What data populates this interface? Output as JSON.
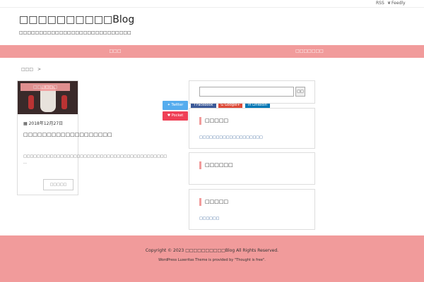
{
  "topbar": {
    "rss": "RSS",
    "feedly": "Feedly"
  },
  "site": {
    "title": "□□□□□□□□□□Blog",
    "description": "□□□□□□□□□□□□□□□□□□□□□□□□□□□□"
  },
  "nav": {
    "items": [
      "□□□",
      "□□□□□□□"
    ]
  },
  "breadcrumb": {
    "home": "□□□",
    "sep": ">"
  },
  "post": {
    "category": "□□□□□□",
    "date": "2018年12月27日",
    "title": "□□□□□□□□□□□□□□□□□□□",
    "excerpt": "□□□□□□□□□□□□□□□□□□□□□□□□□□□□□□□□□□□□□□□□□□□ …",
    "read_more": "□□□□□"
  },
  "share": {
    "twitter": "Twitter",
    "facebook": "Facebook",
    "google": "Google+",
    "linkedin": "LinkedIn",
    "pocket": "Pocket"
  },
  "sidebar": {
    "search_button": "□□",
    "recent": {
      "heading": "□□□□□",
      "link": "□□□□□□□□□□□□□□□□□□□"
    },
    "archive": {
      "heading": "□□□□□□"
    },
    "category": {
      "heading": "□□□□□",
      "link": "□□□□□□"
    }
  },
  "footer": {
    "copyright": "Copyright © 2023 □□□□□□□□□□Blog All Rights Reserved.",
    "credit": "WordPress Luxeritas Theme is provided by \"Thought is free\"."
  },
  "colors": {
    "accent": "#f19b9b",
    "link": "#1a4d8c"
  }
}
